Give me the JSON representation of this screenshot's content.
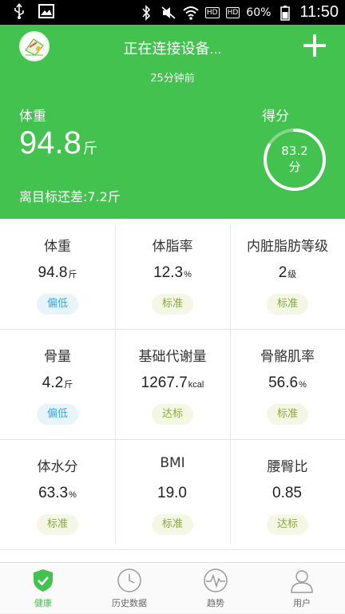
{
  "status_bar": {
    "battery": "60%",
    "time": "11:50",
    "sim1": "HD",
    "sim2": "HD"
  },
  "header": {
    "title": "正在连接设备...",
    "subtitle": "25分钟前",
    "weight_label": "体重",
    "weight_value": "94.8",
    "weight_unit": "斤",
    "diff_text": "离目标还差:7.2斤",
    "score_label": "得分",
    "score_value": "83.2",
    "score_unit": "分",
    "score_fraction": 0.832
  },
  "metrics": [
    {
      "title": "体重",
      "value": "94.8",
      "unit": "斤",
      "status": "偏低",
      "status_type": "low"
    },
    {
      "title": "体脂率",
      "value": "12.3",
      "unit": "%",
      "status": "标准",
      "status_type": "std"
    },
    {
      "title": "内脏脂肪等级",
      "value": "2",
      "unit": "级",
      "status": "标准",
      "status_type": "std"
    },
    {
      "title": "骨量",
      "value": "4.2",
      "unit": "斤",
      "status": "偏低",
      "status_type": "low"
    },
    {
      "title": "基础代谢量",
      "value": "1267.7",
      "unit": "kcal",
      "status": "达标",
      "status_type": "std"
    },
    {
      "title": "骨骼肌率",
      "value": "56.6",
      "unit": "%",
      "status": "标准",
      "status_type": "std"
    },
    {
      "title": "体水分",
      "value": "63.3",
      "unit": "%",
      "status": "标准",
      "status_type": "std"
    },
    {
      "title": "BMI",
      "value": "19.0",
      "unit": "",
      "status": "标准",
      "status_type": "std"
    },
    {
      "title": "腰臀比",
      "value": "0.85",
      "unit": "",
      "status": "达标",
      "status_type": "std"
    }
  ],
  "nav": [
    {
      "label": "健康",
      "icon": "shield-check-icon",
      "active": true
    },
    {
      "label": "历史数据",
      "icon": "clock-icon",
      "active": false
    },
    {
      "label": "趋势",
      "icon": "pulse-icon",
      "active": false
    },
    {
      "label": "用户",
      "icon": "user-icon",
      "active": false
    }
  ],
  "colors": {
    "primary": "#43c24f",
    "low": "#3aa6d8",
    "standard": "#88a93b"
  }
}
